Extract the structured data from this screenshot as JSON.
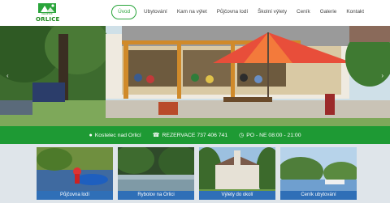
{
  "logo": {
    "text": "ORLICE",
    "subtitle": "KEMPINK"
  },
  "nav": {
    "items": [
      {
        "label": "Úvod",
        "active": true
      },
      {
        "label": "Ubytování"
      },
      {
        "label": "Kam na výlet"
      },
      {
        "label": "Půjčovna lodí"
      },
      {
        "label": "Školní výlety"
      },
      {
        "label": "Ceník"
      },
      {
        "label": "Galerie"
      },
      {
        "label": "Kontakt"
      }
    ]
  },
  "hero": {
    "prev": "‹",
    "next": "›"
  },
  "infobar": {
    "location": "Kostelec nad Orlicí",
    "reservation": "REZERVACE 737 406 741",
    "hours": "PO - NE 08:00 - 21:00",
    "location_icon": "map-marker-icon",
    "phone_icon": "phone-icon",
    "clock_icon": "clock-icon"
  },
  "gallery": [
    {
      "label": "Půjčovna lodí"
    },
    {
      "label": "Rybolov na Orlici"
    },
    {
      "label": "Výlety do okolí"
    },
    {
      "label": "Ceník ubytování"
    }
  ],
  "colors": {
    "accent": "#2aa53b",
    "bar": "#1e9a34",
    "tile_label": "#2f6fb7"
  }
}
